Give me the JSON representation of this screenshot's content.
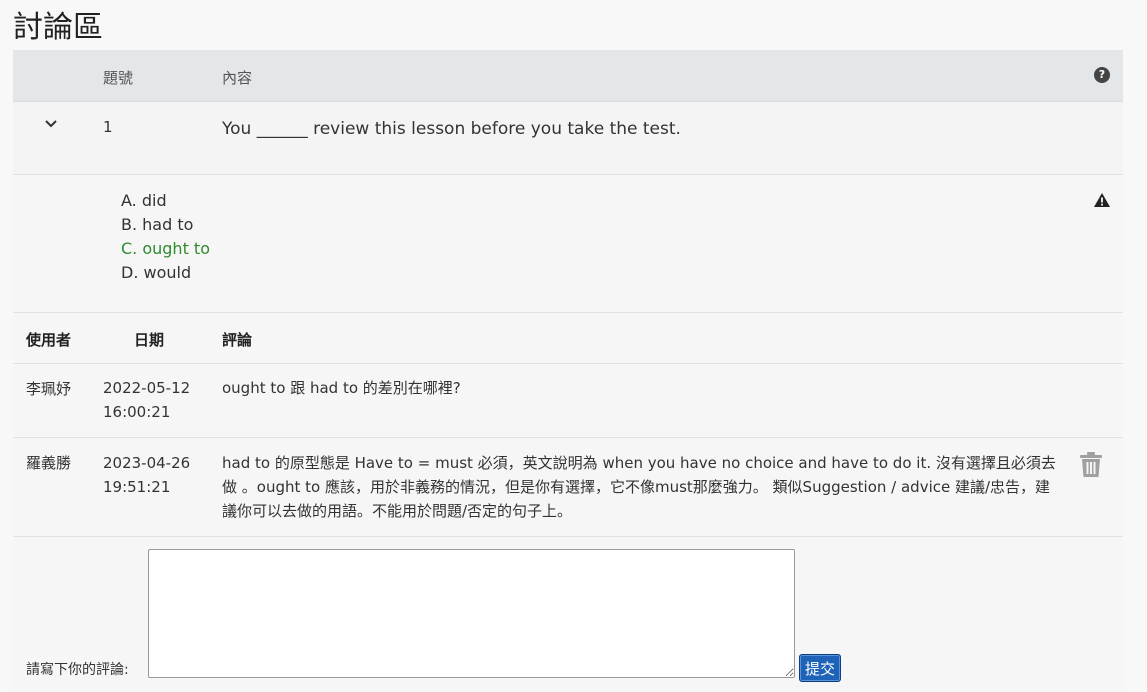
{
  "page": {
    "title": "討論區"
  },
  "table": {
    "headers": {
      "number": "題號",
      "content": "內容"
    }
  },
  "question": {
    "number": "1",
    "text": "You ______ review this lesson before you take the test.",
    "options": [
      {
        "label": "A. did",
        "correct": false
      },
      {
        "label": "B. had to",
        "correct": false
      },
      {
        "label": "C. ought to",
        "correct": true
      },
      {
        "label": "D. would",
        "correct": false
      }
    ]
  },
  "comments": {
    "headers": {
      "user": "使用者",
      "date": "日期",
      "comment": "評論"
    },
    "rows": [
      {
        "user": "李珮妤",
        "date": "2022-05-12",
        "time": "16:00:21",
        "text": "ought to 跟 had to 的差別在哪裡?"
      },
      {
        "user": "羅義勝",
        "date": "2023-04-26",
        "time": "19:51:21",
        "text": "had to 的原型態是 Have to = must 必須，英文說明為 when you have no choice and have to do it. 沒有選擇且必須去做 。ought to 應該，用於非義務的情況，但是你有選擇，它不像must那麼強力。 類似Suggestion / advice 建議/忠告，建議你可以去做的用語。不能用於問題/否定的句子上。"
      }
    ]
  },
  "form": {
    "label": "請寫下你的評論:",
    "value": "",
    "submit_label": "提交"
  },
  "icons": [
    "help-icon",
    "chevron-down-icon",
    "warning-icon",
    "trash-icon"
  ],
  "colors": {
    "correct": "#2e8b2e",
    "submit": "#1e63b8",
    "header_bg": "#e4e7ea"
  }
}
